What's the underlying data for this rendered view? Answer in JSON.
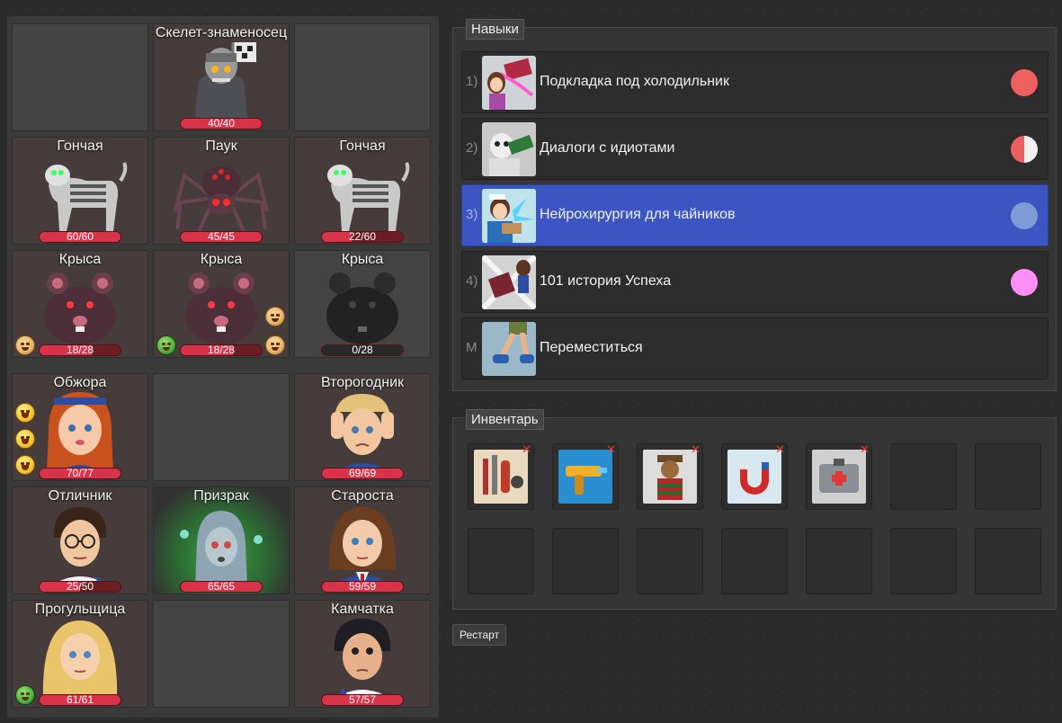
{
  "board": {
    "cells": [
      {
        "name": "",
        "hp": ""
      },
      {
        "name": "Скелет-знаменосец",
        "hp": "40/40"
      },
      {
        "name": "",
        "hp": ""
      },
      {
        "name": "Гончая",
        "hp": "60/60"
      },
      {
        "name": "Паук",
        "hp": "45/45"
      },
      {
        "name": "Гончая",
        "hp": "22/60"
      },
      {
        "name": "Крыса",
        "hp": "18/28"
      },
      {
        "name": "Крыса",
        "hp": "18/28"
      },
      {
        "name": "Крыса",
        "hp": "0/28"
      },
      {
        "name": "Обжора",
        "hp": "70/77"
      },
      {
        "name": "",
        "hp": ""
      },
      {
        "name": "Второгодник",
        "hp": "69/69"
      },
      {
        "name": "Отличник",
        "hp": "25/50"
      },
      {
        "name": "Призрак",
        "hp": "65/65"
      },
      {
        "name": "Староста",
        "hp": "59/59"
      },
      {
        "name": "Прогульщица",
        "hp": "61/61"
      },
      {
        "name": "",
        "hp": ""
      },
      {
        "name": "Камчатка",
        "hp": "57/57"
      }
    ]
  },
  "skills": {
    "title": "Навыки",
    "items": [
      {
        "num": "1)",
        "label": "Подкладка под холодильник",
        "color": "#ee5f5f"
      },
      {
        "num": "2)",
        "label": "Диалоги с идиотами",
        "color": "split"
      },
      {
        "num": "3)",
        "label": "Нейрохирургия для чайников",
        "color": "#7e9ad8"
      },
      {
        "num": "4)",
        "label": "101 история Успеха",
        "color": "#ff8ff6"
      },
      {
        "num": "M",
        "label": "Переместиться",
        "color": ""
      }
    ]
  },
  "inventory": {
    "title": "Инвентарь",
    "items": [
      "knives-and-tools-icon",
      "water-pistol-icon",
      "teddy-bear-icon",
      "magnet-icon",
      "first-aid-kit-icon"
    ]
  },
  "restart_label": "Рестарт"
}
